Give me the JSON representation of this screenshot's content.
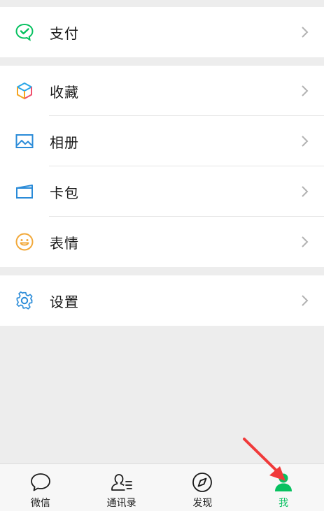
{
  "groups": [
    {
      "items": [
        {
          "label": "支付",
          "icon": "wechat-pay-icon"
        }
      ]
    },
    {
      "items": [
        {
          "label": "收藏",
          "icon": "favorites-cube-icon"
        },
        {
          "label": "相册",
          "icon": "photo-album-icon"
        },
        {
          "label": "卡包",
          "icon": "card-wallet-icon"
        },
        {
          "label": "表情",
          "icon": "smiley-face-icon"
        }
      ]
    },
    {
      "items": [
        {
          "label": "设置",
          "icon": "gear-icon"
        }
      ]
    }
  ],
  "tabbar": {
    "tabs": [
      {
        "label": "微信",
        "icon": "chat-bubble-icon",
        "active": false
      },
      {
        "label": "通讯录",
        "icon": "contacts-icon",
        "active": false
      },
      {
        "label": "发现",
        "icon": "compass-icon",
        "active": false
      },
      {
        "label": "我",
        "icon": "me-person-icon",
        "active": true
      }
    ]
  },
  "colors": {
    "accent": "#07c160",
    "background": "#ededed",
    "arrow": "#f03a3a"
  }
}
